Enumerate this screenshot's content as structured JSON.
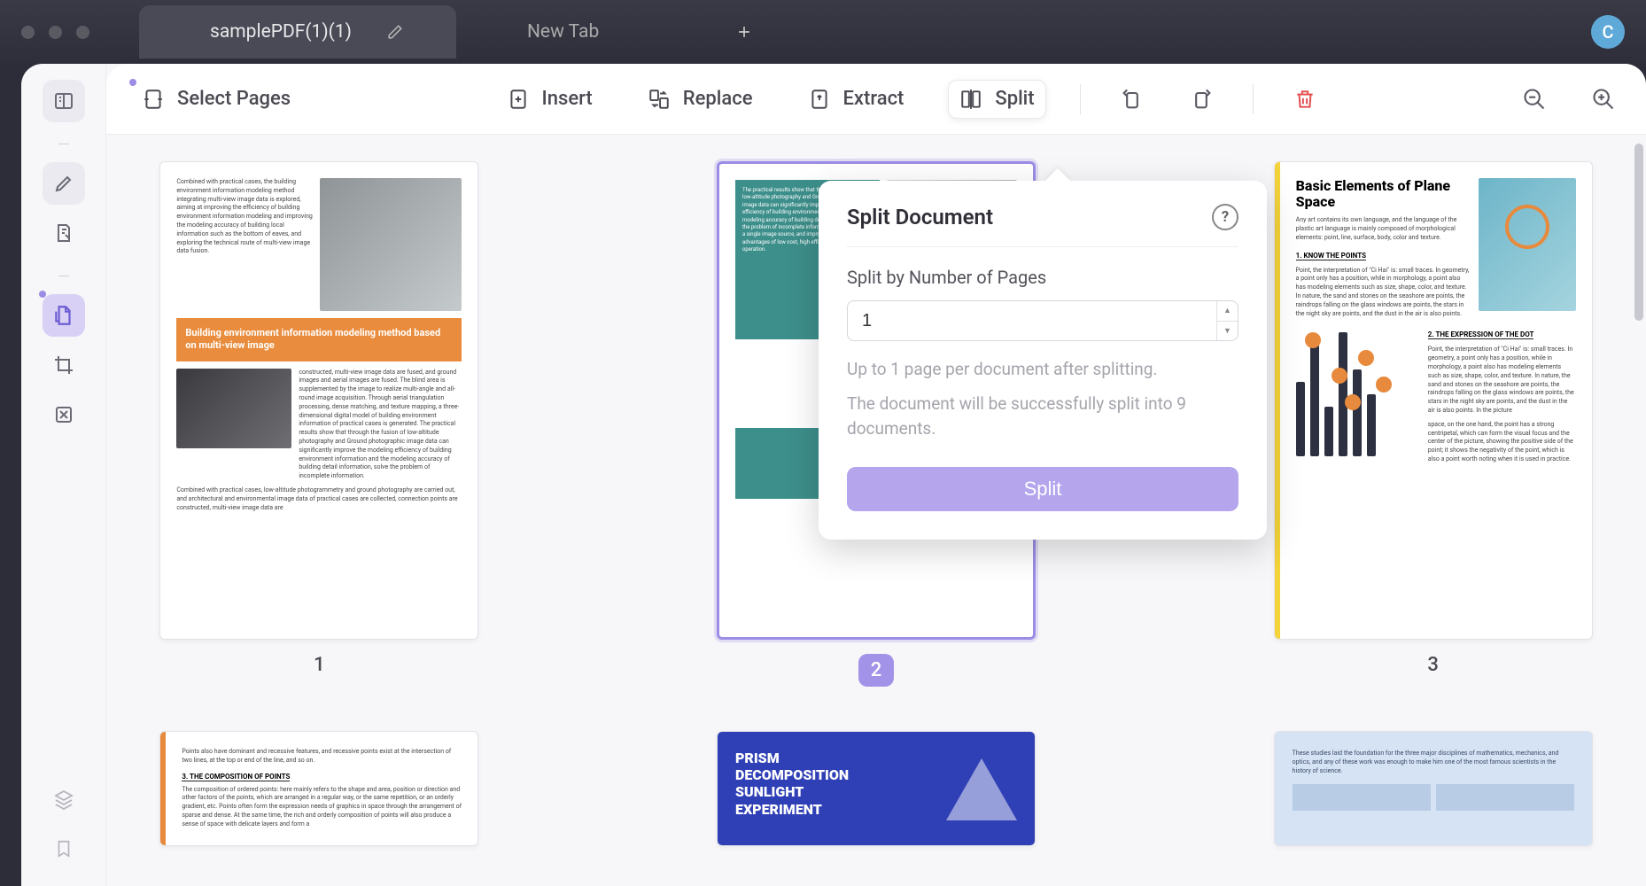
{
  "titlebar": {
    "tabs": [
      {
        "label": "samplePDF(1)(1)",
        "active": true
      },
      {
        "label": "New Tab",
        "active": false
      }
    ],
    "avatar_initial": "C"
  },
  "toolbar": {
    "select_pages": "Select Pages",
    "insert": "Insert",
    "replace": "Replace",
    "extract": "Extract",
    "split": "Split"
  },
  "popover": {
    "title": "Split Document",
    "section_label": "Split by Number of Pages",
    "value": "1",
    "hint_line1": "Up to 1 page per document after splitting.",
    "hint_line2": "The document will be successfully split into 9 documents.",
    "button": "Split"
  },
  "pages": {
    "p1": {
      "num": "1",
      "banner": "Building environment information modeling method based on multi-view image",
      "para_a": "Combined with practical cases, the building environment information modeling method integrating multi-view image data is explored, aiming at improving the efficiency of building environment information modeling and improving the modeling accuracy of building local information such as the bottom of eaves, and exploring the technical route of multi-view image data fusion.",
      "para_b": "constructed, multi-view image data are fused, and ground images and aerial images are fused. The blind area is supplemented by the image to realize multi-angle and all-round image acquisition. Through aerial triangulation processing, dense matching, and texture mapping, a three-dimensional digital model of building environment information of practical cases is generated. The practical results show that through the fusion of low-altitude photography and Ground photographic image data can significantly improve the modeling efficiency of building environment information and the modeling accuracy of building detail information, solve the problem of incomplete information.",
      "para_c": "Combined with practical cases, low-altitude photogrammetry and ground photography are carried out, and architectural and environmental image data of practical cases are collected, connection points are constructed, multi-view image data are"
    },
    "p2": {
      "num": "2",
      "teal": "The practical results show that through the fusion of low-altitude photography and Ground photographic image data can significantly improve the modeling efficiency of building environment information and the modeling accuracy of building detail information, solve the problem of incomplete information collected from a single image source, and improve the technical advantages of low cost, high efficiency, and simple operation."
    },
    "p3": {
      "num": "3",
      "title": "Basic Elements of Plane Space",
      "intro": "Any art contains its own language, and the language of the plastic art language is mainly composed of morphological elements: point, line, surface, body, color and texture.",
      "h1": "1. KNOW THE POINTS",
      "p1_body": "Point, the interpretation of \"Ci Hai\" is: small traces. In geometry, a point only has a position, while in morphology, a point also has modeling elements such as size, shape, color, and texture. In nature, the sand and stones on the seashore are points, the raindrops falling on the glass windows are points, the stars in the night sky are points, and the dust in the air is also points.",
      "h2": "2. THE EXPRESSION OF THE DOT",
      "p2_body": "Point, the interpretation of \"Ci Hai\" is: small traces. In geometry, a point only has a position, while in morphology, a point also has modeling elements such as size, shape, color, and texture. In nature, the sand and stones on the seashore are points, the raindrops falling on the glass windows are points, the stars in the night sky are points, and the dust in the air is also points. In the picture",
      "p3_body": "space, on the one hand, the point has a strong centripetal, which can form the visual focus and the center of the picture, showing the positive side of the point; it shows the negativity of the point, which is also a point worth noting when it is used in practice."
    },
    "row2": {
      "p4": {
        "text_a": "Points also have dominant and recessive features, and recessive points exist at the intersection of two lines, at the top or end of the line, and so on.",
        "h": "3. THE COMPOSITION OF POINTS",
        "text_b": "The composition of ordered points: here mainly refers to the shape and area, position or direction and other factors of the points, which are arranged in a regular way, or the same repetition, or an orderly gradient, etc. Points often form the expression needs of graphics in space through the arrangement of sparse and dense. At the same time, the rich and orderly composition of points will also produce a sense of space with delicate layers and form a"
      },
      "p5": {
        "title": "PRISM DECOMPOSITION SUNLIGHT EXPERIMENT"
      },
      "p6": {
        "text": "These studies laid the foundation for the three major disciplines of mathematics, mechanics, and optics, and any of these work was enough to make him one of the most famous scientists in the history of science."
      }
    }
  }
}
